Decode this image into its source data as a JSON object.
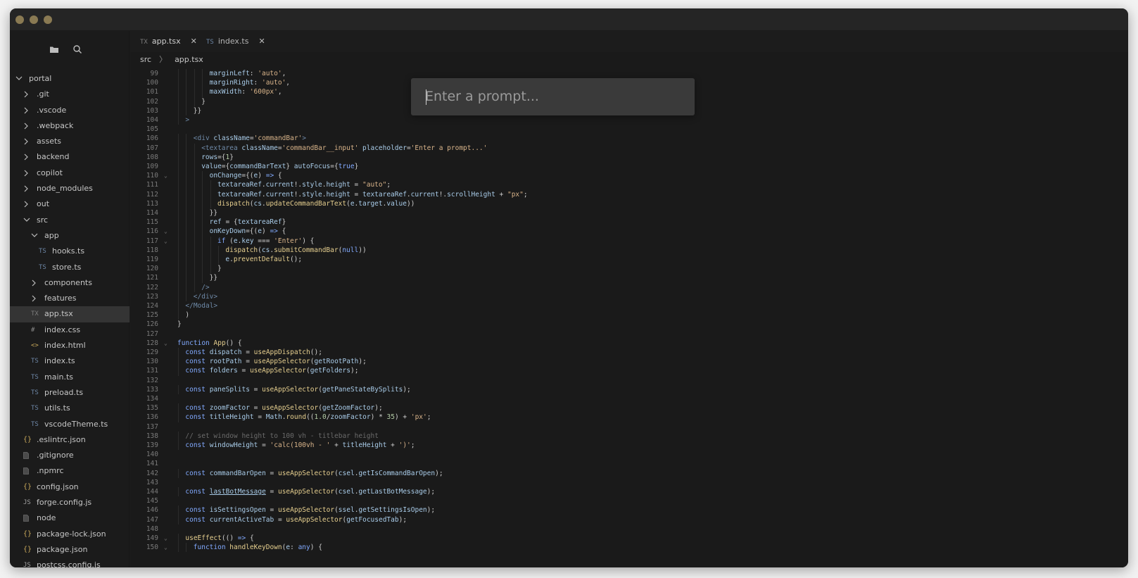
{
  "sidebar": {
    "tree": [
      {
        "label": "portal",
        "type": "folder",
        "open": true,
        "depth": 0
      },
      {
        "label": ".git",
        "type": "folder",
        "open": false,
        "depth": 1
      },
      {
        "label": ".vscode",
        "type": "folder",
        "open": false,
        "depth": 1
      },
      {
        "label": ".webpack",
        "type": "folder",
        "open": false,
        "depth": 1
      },
      {
        "label": "assets",
        "type": "folder",
        "open": false,
        "depth": 1
      },
      {
        "label": "backend",
        "type": "folder",
        "open": false,
        "depth": 1
      },
      {
        "label": "copilot",
        "type": "folder",
        "open": false,
        "depth": 1
      },
      {
        "label": "node_modules",
        "type": "folder",
        "open": false,
        "depth": 1
      },
      {
        "label": "out",
        "type": "folder",
        "open": false,
        "depth": 1
      },
      {
        "label": "src",
        "type": "folder",
        "open": true,
        "depth": 1
      },
      {
        "label": "app",
        "type": "folder",
        "open": true,
        "depth": 2
      },
      {
        "label": "hooks.ts",
        "type": "file",
        "icon": "TS",
        "depth": 3
      },
      {
        "label": "store.ts",
        "type": "file",
        "icon": "TS",
        "depth": 3
      },
      {
        "label": "components",
        "type": "folder",
        "open": false,
        "depth": 2
      },
      {
        "label": "features",
        "type": "folder",
        "open": false,
        "depth": 2
      },
      {
        "label": "app.tsx",
        "type": "file",
        "icon": "TX",
        "depth": 2,
        "selected": true
      },
      {
        "label": "index.css",
        "type": "file",
        "icon": "#",
        "depth": 2
      },
      {
        "label": "index.html",
        "type": "file",
        "icon": "<>",
        "depth": 2
      },
      {
        "label": "index.ts",
        "type": "file",
        "icon": "TS",
        "depth": 2
      },
      {
        "label": "main.ts",
        "type": "file",
        "icon": "TS",
        "depth": 2
      },
      {
        "label": "preload.ts",
        "type": "file",
        "icon": "TS",
        "depth": 2
      },
      {
        "label": "utils.ts",
        "type": "file",
        "icon": "TS",
        "depth": 2
      },
      {
        "label": "vscodeTheme.ts",
        "type": "file",
        "icon": "TS",
        "depth": 2
      },
      {
        "label": ".eslintrc.json",
        "type": "file",
        "icon": "{}",
        "depth": 1
      },
      {
        "label": ".gitignore",
        "type": "file",
        "icon": "doc",
        "depth": 1
      },
      {
        "label": ".npmrc",
        "type": "file",
        "icon": "doc",
        "depth": 1
      },
      {
        "label": "config.json",
        "type": "file",
        "icon": "{}",
        "depth": 1
      },
      {
        "label": "forge.config.js",
        "type": "file",
        "icon": "JS",
        "depth": 1
      },
      {
        "label": "node",
        "type": "file",
        "icon": "doc",
        "depth": 1
      },
      {
        "label": "package-lock.json",
        "type": "file",
        "icon": "{}",
        "depth": 1
      },
      {
        "label": "package.json",
        "type": "file",
        "icon": "{}",
        "depth": 1
      },
      {
        "label": "postcss.config.js",
        "type": "file",
        "icon": "JS",
        "depth": 1
      }
    ]
  },
  "tabs": [
    {
      "icon": "TX",
      "label": "app.tsx",
      "close": "✕",
      "active": true
    },
    {
      "icon": "TS",
      "label": "index.ts",
      "close": "✕",
      "active": false
    }
  ],
  "breadcrumb": {
    "parts": [
      "src",
      "app.tsx"
    ],
    "separator": "〉"
  },
  "prompt": {
    "placeholder": "Enter a prompt..."
  },
  "editor": {
    "lines": [
      {
        "n": "99",
        "fold": "",
        "indent": 4,
        "html": "<span class=\"tk-attr\">marginLeft</span>: <span class=\"tk-str\">'auto'</span>,"
      },
      {
        "n": "100",
        "fold": "",
        "indent": 4,
        "html": "<span class=\"tk-attr\">marginRight</span>: <span class=\"tk-str\">'auto'</span>,"
      },
      {
        "n": "101",
        "fold": "",
        "indent": 4,
        "html": "<span class=\"tk-attr\">maxWidth</span>: <span class=\"tk-str\">'600px'</span>,"
      },
      {
        "n": "102",
        "fold": "",
        "indent": 3,
        "html": "}"
      },
      {
        "n": "103",
        "fold": "",
        "indent": 2,
        "html": "}}"
      },
      {
        "n": "104",
        "fold": "",
        "indent": 1,
        "html": "<span class=\"tk-tag\">&gt;</span>"
      },
      {
        "n": "105",
        "fold": "",
        "indent": 0,
        "html": ""
      },
      {
        "n": "106",
        "fold": "",
        "indent": 2,
        "html": "<span class=\"tk-tag\">&lt;div</span> <span class=\"tk-attr\">className</span>=<span class=\"tk-str\">'commandBar'</span><span class=\"tk-tag\">&gt;</span>"
      },
      {
        "n": "107",
        "fold": "",
        "indent": 3,
        "html": "<span class=\"tk-tag\">&lt;textarea</span> <span class=\"tk-attr\">className</span>=<span class=\"tk-str\">'commandBar__input'</span> <span class=\"tk-attr\">placeholder</span>=<span class=\"tk-str\">'Enter a prompt...'</span>"
      },
      {
        "n": "108",
        "fold": "",
        "indent": 3,
        "html": "<span class=\"tk-attr\">rows</span>={<span class=\"tk-num\">1</span>}"
      },
      {
        "n": "109",
        "fold": "",
        "indent": 3,
        "html": "<span class=\"tk-attr\">value</span>={<span class=\"tk-var\">commandBarText</span>} <span class=\"tk-attr\">autoFocus</span>={<span class=\"tk-kw\">true</span>}"
      },
      {
        "n": "110",
        "fold": "⌄",
        "indent": 4,
        "html": "<span class=\"tk-attr\">onChange</span>={(<span class=\"tk-var\">e</span>) <span class=\"tk-kw\">=&gt;</span> {"
      },
      {
        "n": "111",
        "fold": "",
        "indent": 5,
        "html": "<span class=\"tk-var\">textareaRef</span>.<span class=\"tk-var\">current</span>!.<span class=\"tk-var\">style</span>.<span class=\"tk-var\">height</span> = <span class=\"tk-str\">\"auto\"</span>;"
      },
      {
        "n": "112",
        "fold": "",
        "indent": 5,
        "html": "<span class=\"tk-var\">textareaRef</span>.<span class=\"tk-var\">current</span>!.<span class=\"tk-var\">style</span>.<span class=\"tk-var\">height</span> = <span class=\"tk-var\">textareaRef</span>.<span class=\"tk-var\">current</span>!.<span class=\"tk-var\">scrollHeight</span> + <span class=\"tk-str\">\"px\"</span>;"
      },
      {
        "n": "113",
        "fold": "",
        "indent": 5,
        "html": "<span class=\"tk-fn\">dispatch</span>(<span class=\"tk-var\">cs</span>.<span class=\"tk-fn\">updateCommandBarText</span>(<span class=\"tk-var\">e</span>.<span class=\"tk-var\">target</span>.<span class=\"tk-var\">value</span>))"
      },
      {
        "n": "114",
        "fold": "",
        "indent": 4,
        "html": "}}"
      },
      {
        "n": "115",
        "fold": "",
        "indent": 4,
        "html": "<span class=\"tk-attr\">ref</span> = {<span class=\"tk-var\">textareaRef</span>}"
      },
      {
        "n": "116",
        "fold": "⌄",
        "indent": 4,
        "html": "<span class=\"tk-attr\">onKeyDown</span>={(<span class=\"tk-var\">e</span>) <span class=\"tk-kw\">=&gt;</span> {"
      },
      {
        "n": "117",
        "fold": "⌄",
        "indent": 5,
        "html": "<span class=\"tk-kw\">if</span> (<span class=\"tk-var\">e</span>.<span class=\"tk-var\">key</span> === <span class=\"tk-str\">'Enter'</span>) {"
      },
      {
        "n": "118",
        "fold": "",
        "indent": 6,
        "html": "<span class=\"tk-fn\">dispatch</span>(<span class=\"tk-var\">cs</span>.<span class=\"tk-fn\">submitCommandBar</span>(<span class=\"tk-kw\">null</span>))"
      },
      {
        "n": "119",
        "fold": "",
        "indent": 6,
        "html": "<span class=\"tk-var\">e</span>.<span class=\"tk-fn\">preventDefault</span>();"
      },
      {
        "n": "120",
        "fold": "",
        "indent": 5,
        "html": "}"
      },
      {
        "n": "121",
        "fold": "",
        "indent": 4,
        "html": "}}"
      },
      {
        "n": "122",
        "fold": "",
        "indent": 3,
        "html": "<span class=\"tk-tag\">/&gt;</span>"
      },
      {
        "n": "123",
        "fold": "",
        "indent": 2,
        "html": "<span class=\"tk-tag\">&lt;/div&gt;</span>"
      },
      {
        "n": "124",
        "fold": "",
        "indent": 1,
        "html": "<span class=\"tk-tag\">&lt;/Modal&gt;</span>"
      },
      {
        "n": "125",
        "fold": "",
        "indent": 1,
        "html": ")"
      },
      {
        "n": "126",
        "fold": "",
        "indent": 0,
        "html": "}"
      },
      {
        "n": "127",
        "fold": "",
        "indent": 0,
        "html": ""
      },
      {
        "n": "128",
        "fold": "⌄",
        "indent": 0,
        "html": "<span class=\"tk-kw\">function</span> <span class=\"tk-fn\">App</span>() {"
      },
      {
        "n": "129",
        "fold": "",
        "indent": 1,
        "html": "<span class=\"tk-kw\">const</span> <span class=\"tk-var\">dispatch</span> = <span class=\"tk-fn\">useAppDispatch</span>();"
      },
      {
        "n": "130",
        "fold": "",
        "indent": 1,
        "html": "<span class=\"tk-kw\">const</span> <span class=\"tk-var\">rootPath</span> = <span class=\"tk-fn\">useAppSelector</span>(<span class=\"tk-var\">getRootPath</span>);"
      },
      {
        "n": "131",
        "fold": "",
        "indent": 1,
        "html": "<span class=\"tk-kw\">const</span> <span class=\"tk-var\">folders</span> = <span class=\"tk-fn\">useAppSelector</span>(<span class=\"tk-var\">getFolders</span>);"
      },
      {
        "n": "132",
        "fold": "",
        "indent": 0,
        "html": ""
      },
      {
        "n": "133",
        "fold": "",
        "indent": 1,
        "html": "<span class=\"tk-kw\">const</span> <span class=\"tk-var\">paneSplits</span> = <span class=\"tk-fn\">useAppSelector</span>(<span class=\"tk-var\">getPaneStateBySplits</span>);"
      },
      {
        "n": "134",
        "fold": "",
        "indent": 0,
        "html": ""
      },
      {
        "n": "135",
        "fold": "",
        "indent": 1,
        "html": "<span class=\"tk-kw\">const</span> <span class=\"tk-var\">zoomFactor</span> = <span class=\"tk-fn\">useAppSelector</span>(<span class=\"tk-var\">getZoomFactor</span>);"
      },
      {
        "n": "136",
        "fold": "",
        "indent": 1,
        "html": "<span class=\"tk-kw\">const</span> <span class=\"tk-var\">titleHeight</span> = <span class=\"tk-var\">Math</span>.<span class=\"tk-fn\">round</span>((<span class=\"tk-num\">1.0</span>/<span class=\"tk-var\">zoomFactor</span>) * <span class=\"tk-num\">35</span>) + <span class=\"tk-str\">'px'</span>;"
      },
      {
        "n": "137",
        "fold": "",
        "indent": 0,
        "html": ""
      },
      {
        "n": "138",
        "fold": "",
        "indent": 1,
        "html": "<span class=\"tk-cm\">// set window height to 100 vh - titlebar height</span>"
      },
      {
        "n": "139",
        "fold": "",
        "indent": 1,
        "html": "<span class=\"tk-kw\">const</span> <span class=\"tk-var\">windowHeight</span> = <span class=\"tk-str\">'calc(100vh - '</span> + <span class=\"tk-var\">titleHeight</span> + <span class=\"tk-str\">')'</span>;"
      },
      {
        "n": "140",
        "fold": "",
        "indent": 0,
        "html": ""
      },
      {
        "n": "141",
        "fold": "",
        "indent": 0,
        "html": ""
      },
      {
        "n": "142",
        "fold": "",
        "indent": 1,
        "html": "<span class=\"tk-kw\">const</span> <span class=\"tk-var\">commandBarOpen</span> = <span class=\"tk-fn\">useAppSelector</span>(<span class=\"tk-var\">csel</span>.<span class=\"tk-var\">getIsCommandBarOpen</span>);"
      },
      {
        "n": "143",
        "fold": "",
        "indent": 0,
        "html": ""
      },
      {
        "n": "144",
        "fold": "",
        "indent": 1,
        "html": "<span class=\"tk-kw\">const</span> <span class=\"tk-var tk-ul\">lastBotMessage</span> = <span class=\"tk-fn\">useAppSelector</span>(<span class=\"tk-var\">csel</span>.<span class=\"tk-var\">getLastBotMessage</span>);"
      },
      {
        "n": "145",
        "fold": "",
        "indent": 0,
        "html": ""
      },
      {
        "n": "146",
        "fold": "",
        "indent": 1,
        "html": "<span class=\"tk-kw\">const</span> <span class=\"tk-var\">isSettingsOpen</span> = <span class=\"tk-fn\">useAppSelector</span>(<span class=\"tk-var\">ssel</span>.<span class=\"tk-var\">getSettingsIsOpen</span>);"
      },
      {
        "n": "147",
        "fold": "",
        "indent": 1,
        "html": "<span class=\"tk-kw\">const</span> <span class=\"tk-var\">currentActiveTab</span> = <span class=\"tk-fn\">useAppSelector</span>(<span class=\"tk-var\">getFocusedTab</span>);"
      },
      {
        "n": "148",
        "fold": "",
        "indent": 0,
        "html": ""
      },
      {
        "n": "149",
        "fold": "⌄",
        "indent": 1,
        "html": "<span class=\"tk-fn\">useEffect</span>(() <span class=\"tk-kw\">=&gt;</span> {"
      },
      {
        "n": "150",
        "fold": "⌄",
        "indent": 2,
        "html": "<span class=\"tk-kw\">function</span> <span class=\"tk-fn\">handleKeyDown</span>(<span class=\"tk-var\">e</span>: <span class=\"tk-kw\">any</span>) {"
      }
    ]
  }
}
